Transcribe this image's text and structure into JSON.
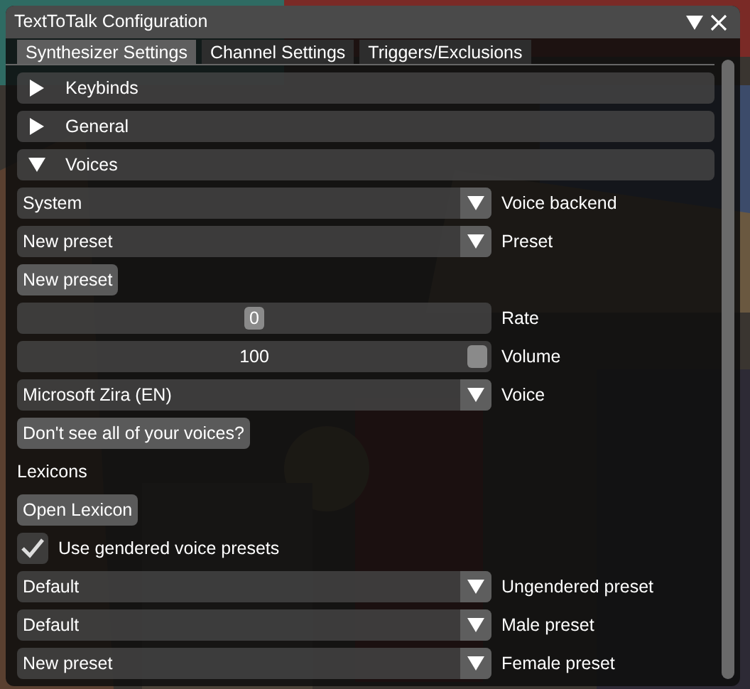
{
  "window": {
    "title": "TextToTalk Configuration"
  },
  "tabs": [
    {
      "label": "Synthesizer Settings",
      "selected": true
    },
    {
      "label": "Channel Settings",
      "selected": false
    },
    {
      "label": "Triggers/Exclusions",
      "selected": false
    }
  ],
  "sections": [
    {
      "label": "Keybinds",
      "expanded": false
    },
    {
      "label": "General",
      "expanded": false
    },
    {
      "label": "Voices",
      "expanded": true
    }
  ],
  "controls": [
    {
      "kind": "combo",
      "value": "System",
      "label": "Voice backend"
    },
    {
      "kind": "combo",
      "value": "New preset",
      "label": "Preset"
    },
    {
      "kind": "button",
      "text": "New preset"
    },
    {
      "kind": "slider",
      "value": "0",
      "level": 0.5,
      "label": "Rate"
    },
    {
      "kind": "slider",
      "value": "100",
      "level": 1,
      "label": "Volume"
    },
    {
      "kind": "combo",
      "value": "Microsoft Zira (EN)",
      "label": "Voice"
    },
    {
      "kind": "button",
      "text": "Don't see all of your voices?"
    },
    {
      "kind": "text",
      "text": "Lexicons"
    },
    {
      "kind": "button",
      "text": "Open Lexicon"
    },
    {
      "kind": "checkbox",
      "checked": true,
      "text": "Use gendered voice presets"
    },
    {
      "kind": "combo",
      "value": "Default",
      "label": "Ungendered preset"
    },
    {
      "kind": "combo",
      "value": "Default",
      "label": "Male preset"
    },
    {
      "kind": "combo",
      "value": "New preset",
      "label": "Female preset"
    }
  ]
}
